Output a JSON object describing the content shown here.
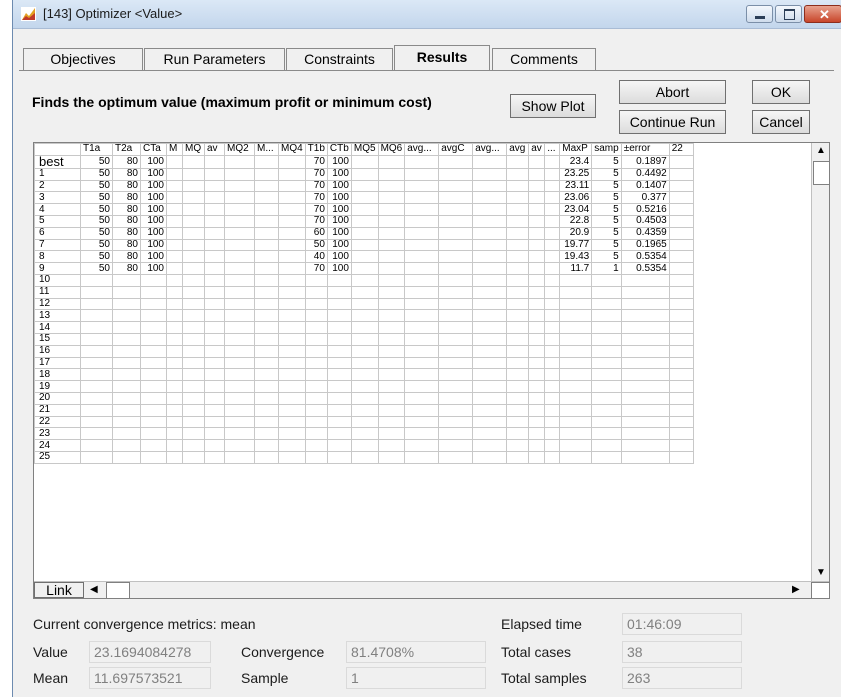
{
  "window": {
    "title": "[143]  Optimizer  <Value>"
  },
  "tabs": [
    {
      "label": "Objectives"
    },
    {
      "label": "Run Parameters"
    },
    {
      "label": "Constraints"
    },
    {
      "label": "Results"
    },
    {
      "label": "Comments"
    }
  ],
  "heading": "Finds the optimum value (maximum profit or minimum cost)",
  "buttons": {
    "show_plot": "Show Plot",
    "abort": "Abort",
    "ok": "OK",
    "continue_run": "Continue Run",
    "cancel": "Cancel",
    "link": "Link"
  },
  "grid": {
    "columns": [
      "",
      "T1a",
      "T2a",
      "CTa",
      "M",
      "MQ",
      "av",
      "MQ2",
      "M...",
      "MQ4",
      "T1b",
      "CTb",
      "MQ5",
      "MQ6",
      "avg...",
      "avgC",
      "avg...",
      "avg",
      "av",
      "...",
      "MaxP",
      "samp",
      "±error",
      "22"
    ],
    "rows": [
      [
        "best",
        "50",
        "80",
        "100",
        "",
        "",
        "",
        "",
        "",
        "",
        "70",
        "100",
        "",
        "",
        "",
        "",
        "",
        "",
        "",
        "",
        "23.4",
        "5",
        "0.1897",
        ""
      ],
      [
        "1",
        "50",
        "80",
        "100",
        "",
        "",
        "",
        "",
        "",
        "",
        "70",
        "100",
        "",
        "",
        "",
        "",
        "",
        "",
        "",
        "",
        "23.25",
        "5",
        "0.4492",
        ""
      ],
      [
        "2",
        "50",
        "80",
        "100",
        "",
        "",
        "",
        "",
        "",
        "",
        "70",
        "100",
        "",
        "",
        "",
        "",
        "",
        "",
        "",
        "",
        "23.11",
        "5",
        "0.1407",
        ""
      ],
      [
        "3",
        "50",
        "80",
        "100",
        "",
        "",
        "",
        "",
        "",
        "",
        "70",
        "100",
        "",
        "",
        "",
        "",
        "",
        "",
        "",
        "",
        "23.06",
        "5",
        "0.377",
        ""
      ],
      [
        "4",
        "50",
        "80",
        "100",
        "",
        "",
        "",
        "",
        "",
        "",
        "70",
        "100",
        "",
        "",
        "",
        "",
        "",
        "",
        "",
        "",
        "23.04",
        "5",
        "0.5216",
        ""
      ],
      [
        "5",
        "50",
        "80",
        "100",
        "",
        "",
        "",
        "",
        "",
        "",
        "70",
        "100",
        "",
        "",
        "",
        "",
        "",
        "",
        "",
        "",
        "22.8",
        "5",
        "0.4503",
        ""
      ],
      [
        "6",
        "50",
        "80",
        "100",
        "",
        "",
        "",
        "",
        "",
        "",
        "60",
        "100",
        "",
        "",
        "",
        "",
        "",
        "",
        "",
        "",
        "20.9",
        "5",
        "0.4359",
        ""
      ],
      [
        "7",
        "50",
        "80",
        "100",
        "",
        "",
        "",
        "",
        "",
        "",
        "50",
        "100",
        "",
        "",
        "",
        "",
        "",
        "",
        "",
        "",
        "19.77",
        "5",
        "0.1965",
        ""
      ],
      [
        "8",
        "50",
        "80",
        "100",
        "",
        "",
        "",
        "",
        "",
        "",
        "40",
        "100",
        "",
        "",
        "",
        "",
        "",
        "",
        "",
        "",
        "19.43",
        "5",
        "0.5354",
        ""
      ],
      [
        "9",
        "50",
        "80",
        "100",
        "",
        "",
        "",
        "",
        "",
        "",
        "70",
        "100",
        "",
        "",
        "",
        "",
        "",
        "",
        "",
        "",
        "11.7",
        "1",
        "0.5354",
        ""
      ],
      [
        "10"
      ],
      [
        "11"
      ],
      [
        "12"
      ],
      [
        "13"
      ],
      [
        "14"
      ],
      [
        "15"
      ],
      [
        "16"
      ],
      [
        "17"
      ],
      [
        "18"
      ],
      [
        "19"
      ],
      [
        "20"
      ],
      [
        "21"
      ],
      [
        "22"
      ],
      [
        "23"
      ],
      [
        "24"
      ],
      [
        "25"
      ]
    ]
  },
  "metrics": {
    "heading": "Current convergence metrics: mean",
    "value_label": "Value",
    "value": "23.1694084278",
    "mean_label": "Mean",
    "mean": "11.697573521",
    "convergence_label": "Convergence",
    "convergence": "81.4708%",
    "sample_label": "Sample",
    "sample": "1",
    "elapsed_label": "Elapsed time",
    "elapsed": "01:46:09",
    "total_cases_label": "Total cases",
    "total_cases": "38",
    "total_samples_label": "Total samples",
    "total_samples": "263"
  },
  "icons": {
    "app": "chart-app-icon",
    "minimize": "minimize-icon",
    "maximize": "maximize-icon",
    "close": "close-icon"
  },
  "colors": {
    "titlebar": "#c3d6ec",
    "close_button": "#c8452a"
  }
}
